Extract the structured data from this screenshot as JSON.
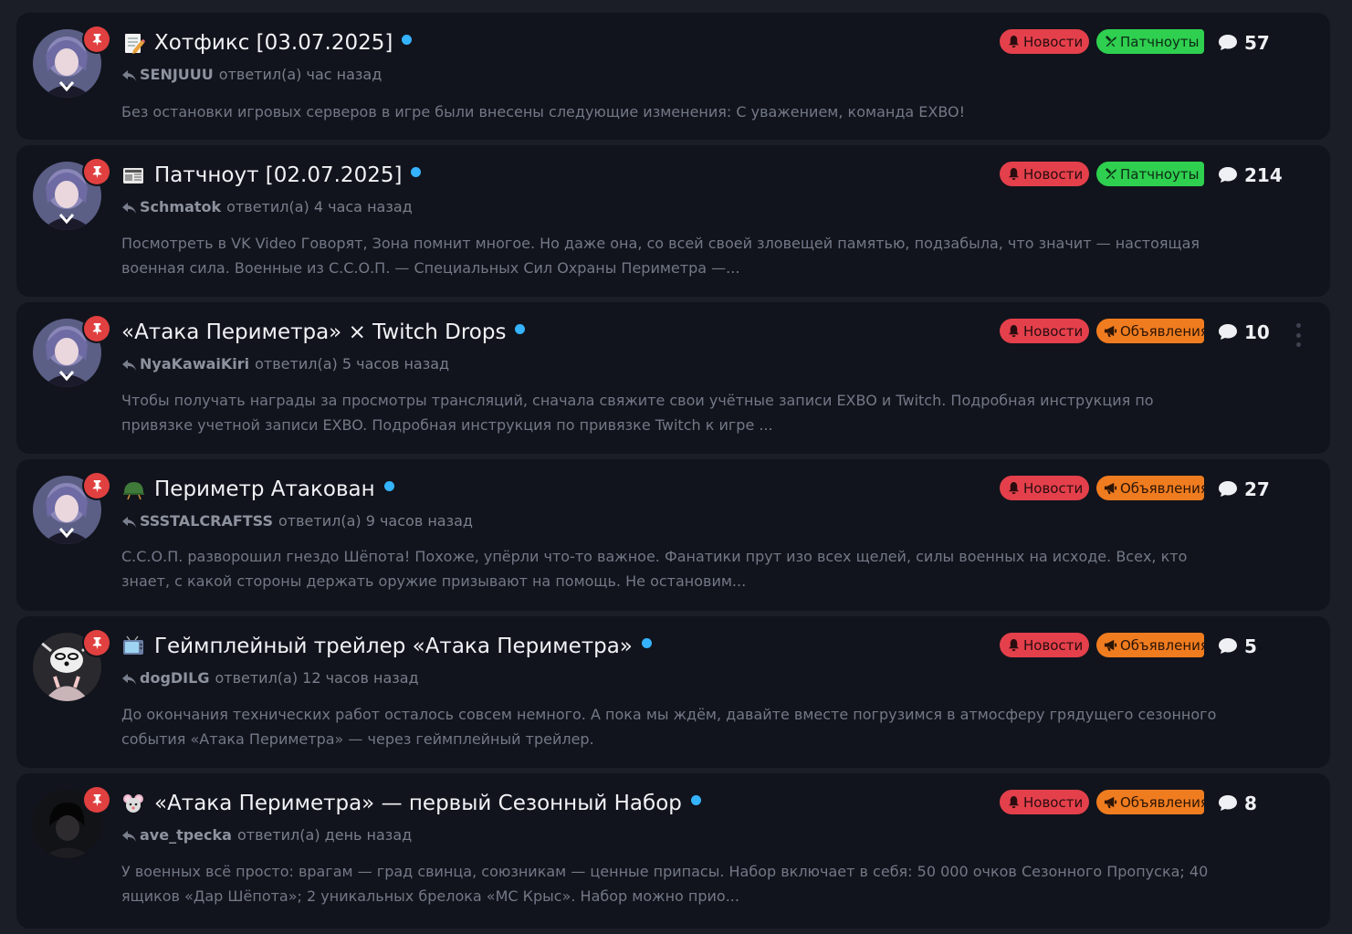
{
  "topics": [
    {
      "emoji": "memo-icon",
      "title": "Хотфикс [03.07.2025]",
      "user": "SENJUUU",
      "reply_text": "ответил(а) час назад",
      "excerpt": "Без остановки игровых серверов в игре были внесены следующие изменения: С уважением, команда EXBO!",
      "tags": [
        "Новости",
        "Патчноуты"
      ],
      "comments": "57",
      "avatar": "anime-girl"
    },
    {
      "emoji": "newspaper-icon",
      "title": "Патчноут [02.07.2025]",
      "user": "Schmatok",
      "reply_text": "ответил(а) 4 часа назад",
      "excerpt": "Посмотреть в VK Video Говорят, Зона помнит многое. Но даже она, со всей своей зловещей памятью, подзабыла, что значит — настоящая военная сила. Военные из С.С.О.П. — Специальных Сил Охраны Периметра —...",
      "tags": [
        "Новости",
        "Патчноуты"
      ],
      "comments": "214",
      "avatar": "anime-girl"
    },
    {
      "emoji": "",
      "title": "«Атака Периметра» × Twitch Drops",
      "user": "NyaKawaiKiri",
      "reply_text": "ответил(а) 5 часов назад",
      "excerpt": "Чтобы получать награды за просмотры трансляций, сначала свяжите свои учётные записи EXBO и Twitch. Подробная инструкция по привязке учетной записи EXBO. Подробная инструкция по привязке Twitch к игре ...",
      "tags": [
        "Новости",
        "Объявления"
      ],
      "comments": "10",
      "avatar": "anime-girl",
      "has_menu": true
    },
    {
      "emoji": "military-helmet-icon",
      "title": "Периметр Атакован",
      "user": "SSSTALCRAFTSS",
      "reply_text": "ответил(а) 9 часов назад",
      "excerpt": "С.С.О.П. разворошил гнездо Шёпота! Похоже, упёрли что-то важное. Фанатики прут изо всех щелей, силы военных на исходе. Всех, кто знает, с какой стороны держать оружие призывают на помощь. Не остановим...",
      "tags": [
        "Новости",
        "Объявления"
      ],
      "comments": "27",
      "avatar": "anime-girl"
    },
    {
      "emoji": "television-icon",
      "title": "Геймплейный трейлер «Атака Периметра»",
      "user": "dogDILG",
      "reply_text": "ответил(а) 12 часов назад",
      "excerpt": "До окончания технических работ осталось совсем немного. А пока мы ждём, давайте вместе погрузимся в атмосферу грядущего сезонного события «Атака Периметра» — через геймплейный трейлер.",
      "tags": [
        "Новости",
        "Объявления"
      ],
      "comments": "5",
      "avatar": "dog-meme"
    },
    {
      "emoji": "mouse-face-icon",
      "title": "«Атака Периметра» — первый Сезонный Набор",
      "user": "ave_tpecka",
      "reply_text": "ответил(а) день назад",
      "excerpt": "У военных всё просто: врагам — град свинца, союзникам — ценные припасы. Набор включает в себя: 50 000 очков Сезонного Пропуска; 40 ящиков «Дар Шёпота»; 2 уникальных брелока «МС Крыс». Набор можно прио...",
      "tags": [
        "Новости",
        "Объявления"
      ],
      "comments": "8",
      "avatar": "dark-figure"
    }
  ],
  "colors": {
    "tag_news": "#e4404b",
    "tag_patch": "#2fcf50",
    "tag_announce": "#f07c20",
    "unread_dot": "#35b3ff",
    "pin": "#e14040"
  }
}
